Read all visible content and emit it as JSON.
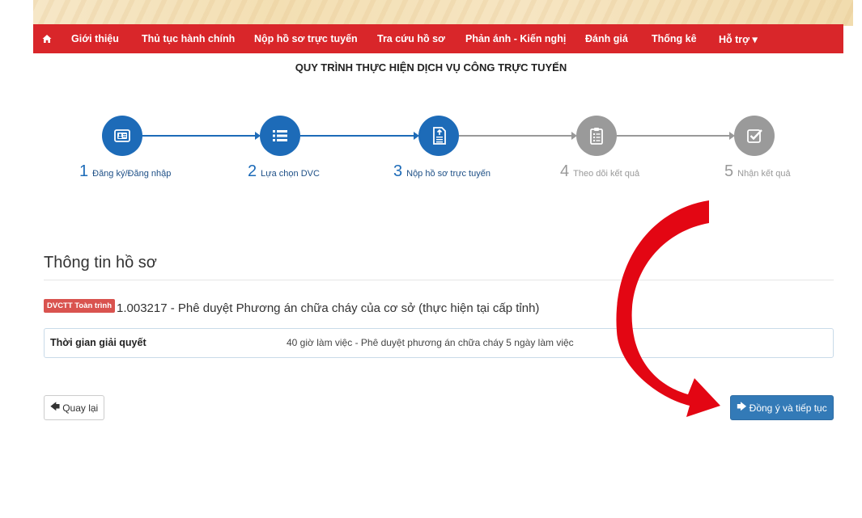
{
  "navbar": {
    "home_icon": "home-icon",
    "items": [
      {
        "label": "Giới thiệu"
      },
      {
        "label": "Thủ tục hành chính"
      },
      {
        "label": "Nộp hồ sơ trực tuyến"
      },
      {
        "label": "Tra cứu hồ sơ"
      },
      {
        "label": "Phản ánh - Kiến nghị"
      },
      {
        "label": "Đánh giá"
      },
      {
        "label": "Thống kê"
      },
      {
        "label": "Hỗ trợ ▾"
      }
    ],
    "color": "#d9262a"
  },
  "process": {
    "title": "QUY TRÌNH THỰC HIỆN DỊCH VỤ CÔNG TRỰC TUYẾN",
    "steps": [
      {
        "num": "1",
        "label": "Đăng ký/Đăng nhập",
        "icon": "id-card-icon",
        "status": "done"
      },
      {
        "num": "2",
        "label": "Lựa chọn DVC",
        "icon": "list-icon",
        "status": "done"
      },
      {
        "num": "3",
        "label": "Nộp hồ sơ trực tuyến",
        "icon": "document-upload-icon",
        "status": "done"
      },
      {
        "num": "4",
        "label": "Theo dõi kết quả",
        "icon": "clipboard-list-icon",
        "status": "todo"
      },
      {
        "num": "5",
        "label": "Nhận kết quả",
        "icon": "check-square-icon",
        "status": "todo"
      }
    ],
    "active_color": "#1d6bb8",
    "inactive_color": "#9a9a9a"
  },
  "record": {
    "section_title": "Thông tin hồ sơ",
    "badge": "DVCTT Toàn trình",
    "service_name": "1.003217 - Phê duyệt Phương án chữa cháy của cơ sở (thực hiện tại cấp tỉnh)",
    "resolution_time_label": "Thời gian giải quyết",
    "resolution_time_value": "40 giờ làm việc - Phê duyệt phương án chữa cháy 5 ngày làm việc"
  },
  "actions": {
    "back_label": "Quay lại",
    "back_icon": "arrow-left-icon",
    "next_label": "Đồng ý và tiếp tục",
    "next_icon": "arrow-right-icon",
    "next_color": "#337ab7"
  },
  "annotation": {
    "arrow_icon": "red-curved-arrow-icon",
    "color": "#e30613"
  }
}
